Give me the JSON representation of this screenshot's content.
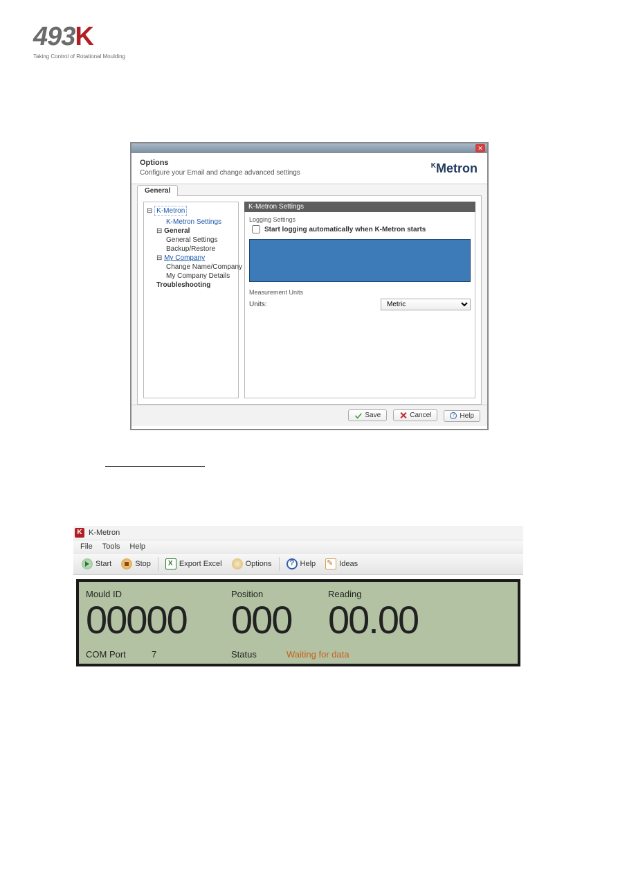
{
  "page_header": {
    "logo_number": "493",
    "logo_letter": "K",
    "tagline": "Taking Control of Rotational Moulding"
  },
  "options_window": {
    "title": "Options",
    "subtitle": "Configure your Email and change advanced settings",
    "brand_prefix": "K",
    "brand_name": "Metron",
    "tab_label": "General",
    "tree": {
      "root": "K-Metron",
      "kmetron_settings": "K-Metron Settings",
      "general": "General",
      "general_settings": "General Settings",
      "backup_restore": "Backup/Restore",
      "my_company": "My Company",
      "change_name": "Change Name/Company",
      "my_company_details": "My Company Details",
      "troubleshooting": "Troubleshooting"
    },
    "settings": {
      "panel_title": "K-Metron Settings",
      "logging_label": "Logging Settings",
      "auto_start_label": "Start logging automatically when K-Metron starts",
      "measurement_label": "Measurement Units",
      "units_label": "Units:",
      "units_value": "Metric"
    },
    "buttons": {
      "save": "Save",
      "cancel": "Cancel",
      "help": "Help"
    }
  },
  "section_heading": "",
  "app_window": {
    "title": "K-Metron",
    "menu": {
      "file": "File",
      "tools": "Tools",
      "help": "Help"
    },
    "toolbar": {
      "start": "Start",
      "stop": "Stop",
      "export": "Export Excel",
      "options": "Options",
      "help": "Help",
      "ideas": "Ideas"
    },
    "lcd": {
      "mould_id_label": "Mould ID",
      "mould_id_value": "00000",
      "position_label": "Position",
      "position_value": "000",
      "reading_label": "Reading",
      "reading_value": "00.00",
      "com_port_label": "COM Port",
      "com_port_value": "7",
      "status_label": "Status",
      "status_value": "Waiting for data"
    }
  }
}
